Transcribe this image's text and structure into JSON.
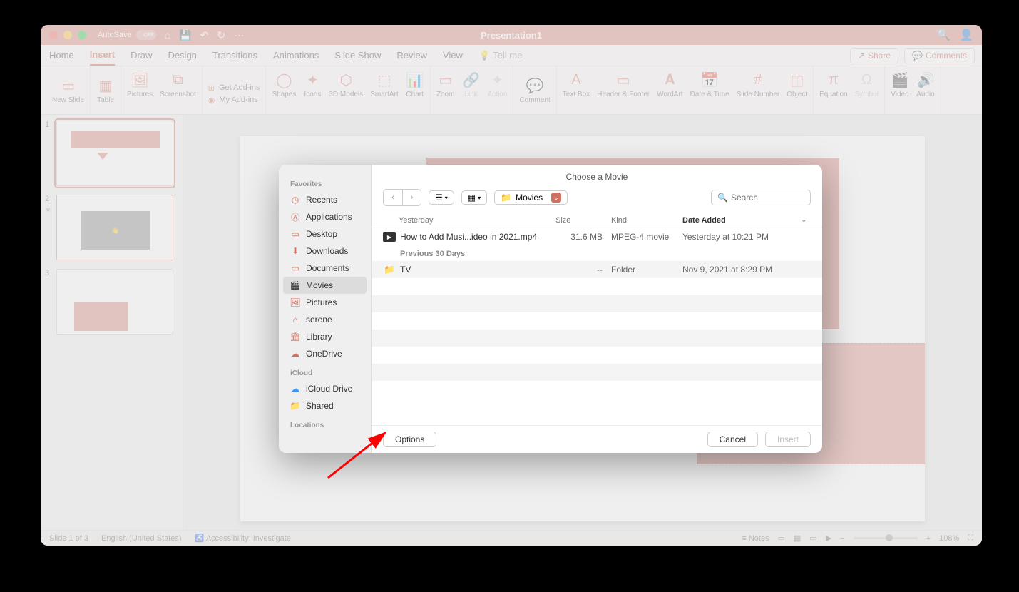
{
  "titlebar": {
    "autosave_label": "AutoSave",
    "autosave_state": "OFF",
    "title": "Presentation1"
  },
  "tabs": {
    "items": [
      "Home",
      "Insert",
      "Draw",
      "Design",
      "Transitions",
      "Animations",
      "Slide Show",
      "Review",
      "View"
    ],
    "active_index": 1,
    "tellme": "Tell me",
    "share": "Share",
    "comments": "Comments"
  },
  "ribbon": {
    "new_slide": "New Slide",
    "table": "Table",
    "pictures": "Pictures",
    "screenshot": "Screenshot",
    "get_addins": "Get Add-ins",
    "my_addins": "My Add-ins",
    "shapes": "Shapes",
    "icons": "Icons",
    "models": "3D Models",
    "smartart": "SmartArt",
    "chart": "Chart",
    "zoom": "Zoom",
    "link": "Link",
    "action": "Action",
    "comment": "Comment",
    "textbox": "Text Box",
    "headerfooter": "Header & Footer",
    "wordart": "WordArt",
    "datetime": "Date & Time",
    "slidenumber": "Slide Number",
    "object": "Object",
    "equation": "Equation",
    "symbol": "Symbol",
    "video": "Video",
    "audio": "Audio"
  },
  "slides": {
    "count": 3,
    "selected": 1
  },
  "statusbar": {
    "slide_info": "Slide 1 of 3",
    "language": "English (United States)",
    "accessibility": "Accessibility: Investigate",
    "notes": "Notes",
    "zoom": "108%"
  },
  "dialog": {
    "title": "Choose a Movie",
    "path": "Movies",
    "search_placeholder": "Search",
    "sidebar": {
      "favorites_label": "Favorites",
      "favorites": [
        "Recents",
        "Applications",
        "Desktop",
        "Downloads",
        "Documents",
        "Movies",
        "Pictures",
        "serene",
        "Library",
        "OneDrive"
      ],
      "icloud_label": "iCloud",
      "icloud": [
        "iCloud Drive",
        "Shared"
      ],
      "locations_label": "Locations"
    },
    "columns": {
      "size": "Size",
      "kind": "Kind",
      "date_added": "Date Added"
    },
    "groups": [
      {
        "label": "Yesterday",
        "files": [
          {
            "name": "How to Add Musi...ideo in 2021.mp4",
            "size": "31.6 MB",
            "kind": "MPEG-4 movie",
            "date": "Yesterday at 10:21 PM",
            "icon": "video"
          }
        ]
      },
      {
        "label": "Previous 30 Days",
        "files": [
          {
            "name": "TV",
            "size": "--",
            "kind": "Folder",
            "date": "Nov 9, 2021 at 8:29 PM",
            "icon": "folder"
          }
        ]
      }
    ],
    "footer": {
      "options": "Options",
      "cancel": "Cancel",
      "insert": "Insert"
    }
  }
}
